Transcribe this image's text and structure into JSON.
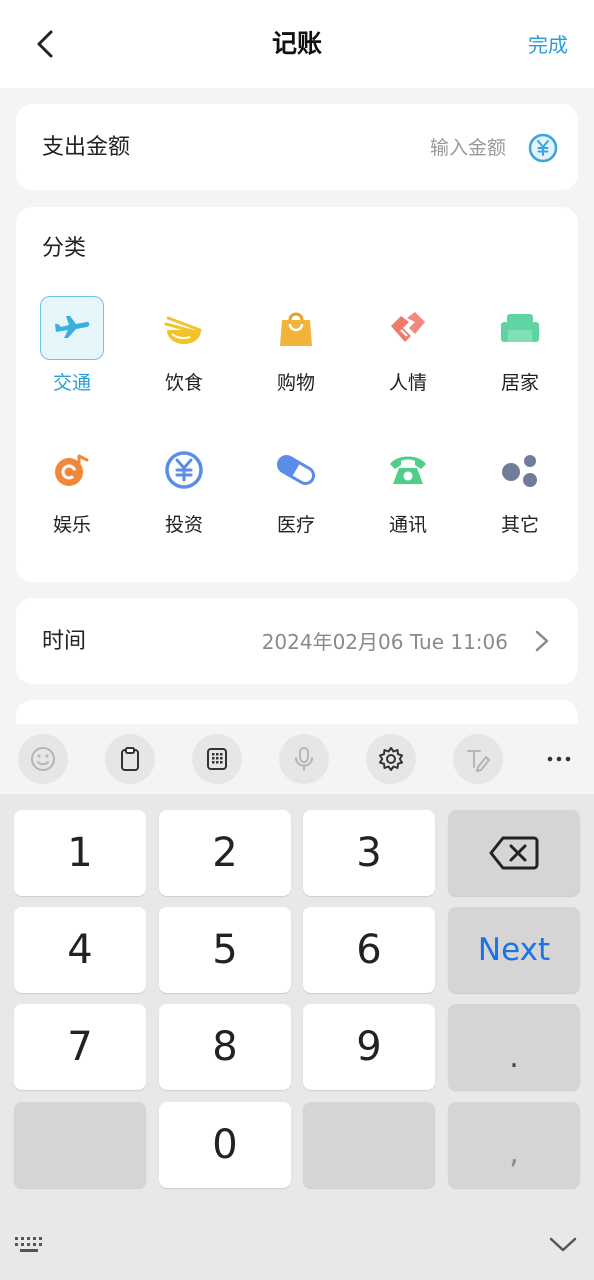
{
  "header": {
    "title": "记账",
    "done_label": "完成"
  },
  "amount": {
    "label": "支出金额",
    "placeholder": "输入金额"
  },
  "category": {
    "title": "分类",
    "selected": "交通",
    "items": [
      {
        "label": "交通",
        "icon": "airplane-icon",
        "color": "#3ab0e0"
      },
      {
        "label": "饮食",
        "icon": "bowl-icon",
        "color": "#f2c32b"
      },
      {
        "label": "购物",
        "icon": "shopping-bag-icon",
        "color": "#f2b33a"
      },
      {
        "label": "人情",
        "icon": "handshake-icon",
        "color": "#f2786c"
      },
      {
        "label": "居家",
        "icon": "sofa-icon",
        "color": "#5fd3a2"
      },
      {
        "label": "娱乐",
        "icon": "music-disc-icon",
        "color": "#f2873a"
      },
      {
        "label": "投资",
        "icon": "yen-coin-icon",
        "color": "#5b8de8"
      },
      {
        "label": "医疗",
        "icon": "pill-icon",
        "color": "#5b8de8"
      },
      {
        "label": "通讯",
        "icon": "telephone-icon",
        "color": "#4fcf8a"
      },
      {
        "label": "其它",
        "icon": "dots-icon",
        "color": "#6f7c9a"
      }
    ]
  },
  "time": {
    "label": "时间",
    "value": "2024年02月06 Tue 11:06"
  },
  "keyboard": {
    "toolbar": [
      "emoji-icon",
      "clipboard-icon",
      "numeric-keypad-icon",
      "microphone-icon",
      "settings-icon",
      "handwriting-icon",
      "more-icon"
    ],
    "keys": {
      "k1": "1",
      "k2": "2",
      "k3": "3",
      "k4": "4",
      "k5": "5",
      "k6": "6",
      "next": "Next",
      "k7": "7",
      "k8": "8",
      "k9": "9",
      "dot": ".",
      "k0": "0",
      "comma": ","
    }
  },
  "colors": {
    "accent": "#2a9fd6",
    "next_key": "#1a73e8"
  }
}
